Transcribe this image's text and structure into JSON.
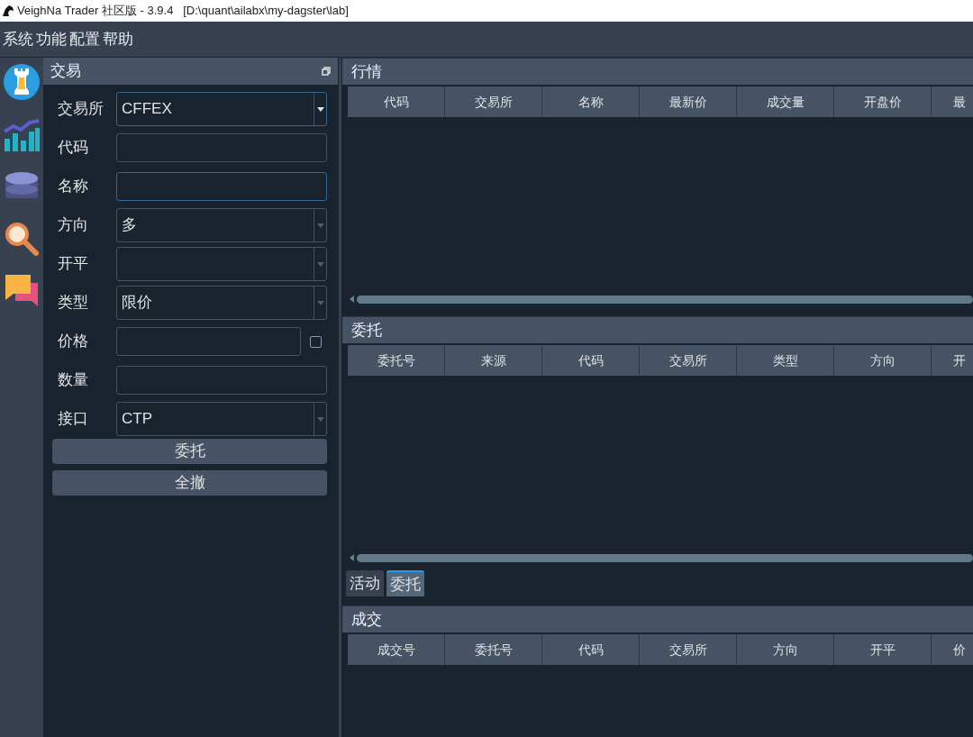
{
  "window": {
    "title": "VeighNa Trader 社区版 - 3.9.4   [D:\\quant\\ailabx\\my-dagster\\lab]"
  },
  "menu": [
    "系统",
    "功能",
    "配置",
    "帮助"
  ],
  "trade_panel": {
    "title": "交易",
    "fields": [
      {
        "kind": "combo",
        "label": "交易所",
        "value": "CFFEX",
        "focused": true
      },
      {
        "kind": "input",
        "label": "代码",
        "focused": false
      },
      {
        "kind": "input",
        "label": "名称",
        "focused": true
      },
      {
        "kind": "combo",
        "label": "方向",
        "value": "多",
        "focused": false
      },
      {
        "kind": "combo",
        "label": "开平",
        "focused": false
      },
      {
        "kind": "combo",
        "label": "类型",
        "value": "限价",
        "focused": false
      },
      {
        "kind": "price",
        "label": "价格",
        "focused": false,
        "checked": false
      },
      {
        "kind": "input",
        "label": "数量",
        "focused": false
      },
      {
        "kind": "combo",
        "label": "接口",
        "value": "CTP",
        "focused": false
      }
    ],
    "buttons": [
      "委托",
      "全撤"
    ]
  },
  "market_panel": {
    "title": "行情",
    "columns": [
      "代码",
      "交易所",
      "名称",
      "最新价",
      "成交量",
      "开盘价",
      "最"
    ]
  },
  "order_panel": {
    "title": "委托",
    "columns": [
      "委托号",
      "来源",
      "代码",
      "交易所",
      "类型",
      "方向",
      "开"
    ],
    "tabs": [
      {
        "label": "活动",
        "selected": false
      },
      {
        "label": "委托",
        "selected": true
      }
    ]
  },
  "trade_records_panel": {
    "title": "成交",
    "columns": [
      "成交号",
      "委托号",
      "代码",
      "交易所",
      "方向",
      "开平",
      "价"
    ]
  }
}
